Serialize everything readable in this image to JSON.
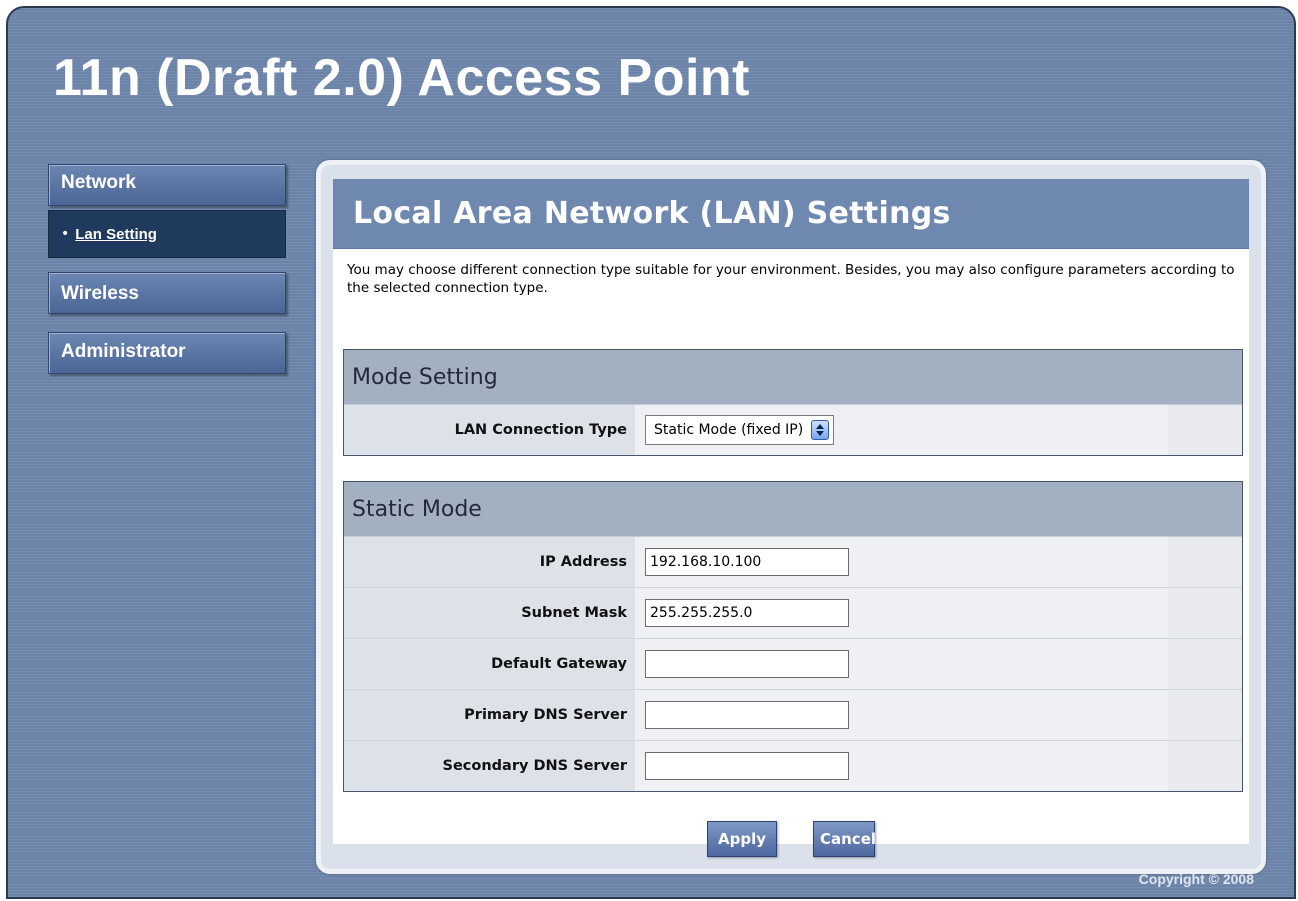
{
  "app": {
    "title": "11n (Draft 2.0) Access Point"
  },
  "sidebar": {
    "network": "Network",
    "lan_setting": "Lan Setting",
    "wireless": "Wireless",
    "administrator": "Administrator"
  },
  "page": {
    "title": "Local Area Network (LAN) Settings",
    "intro": "You may choose different connection type suitable for your environment. Besides, you may also configure parameters according to the selected connection type."
  },
  "mode_setting": {
    "heading": "Mode Setting",
    "connection_type_label": "LAN Connection Type",
    "connection_type_value": "Static Mode (fixed IP)"
  },
  "static_mode": {
    "heading": "Static Mode",
    "fields": [
      {
        "label": "IP Address",
        "value": "192.168.10.100"
      },
      {
        "label": "Subnet Mask",
        "value": "255.255.255.0"
      },
      {
        "label": "Default Gateway",
        "value": ""
      },
      {
        "label": "Primary DNS Server",
        "value": ""
      },
      {
        "label": "Secondary DNS Server",
        "value": ""
      }
    ]
  },
  "actions": {
    "apply": "Apply",
    "cancel": "Cancel"
  },
  "footer": {
    "copyright": "Copyright © 2008"
  }
}
